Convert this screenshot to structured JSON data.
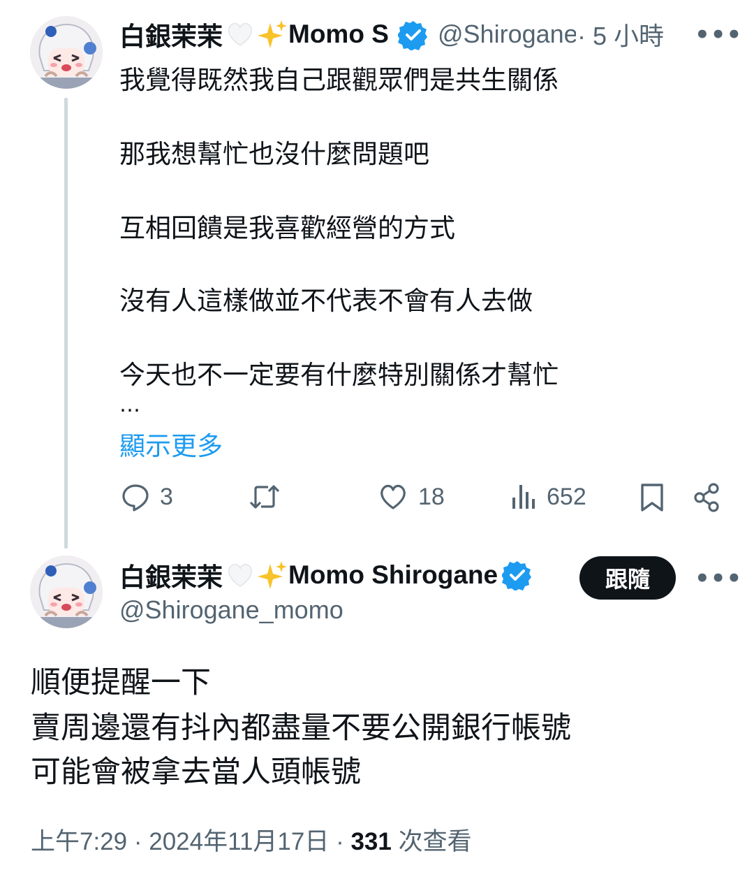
{
  "reply_tweet": {
    "display_name_prefix": "白銀茉茉",
    "display_name_suffix": "Momo S",
    "handle": "@Shirogane",
    "time": "· 5 小時",
    "lines": [
      "我覺得既然我自己跟觀眾們是共生關係",
      "那我想幫忙也沒什麼問題吧",
      "互相回饋是我喜歡經營的方式",
      "沒有人這樣做並不代表不會有人去做",
      "今天也不一定要有什麼特別關係才幫忙",
      "…"
    ],
    "show_more": "顯示更多",
    "actions": {
      "reply_count": "3",
      "retweet_count": "",
      "like_count": "18",
      "view_count": "652"
    }
  },
  "main_tweet": {
    "display_name_prefix": "白銀茉茉",
    "display_name_suffix": "Momo Shirogane",
    "handle": "@Shirogane_momo",
    "follow_label": "跟隨",
    "lines": [
      "順便提醒一下",
      "賣周邊還有抖內都盡量不要公開銀行帳號",
      "可能會被拿去當人頭帳號"
    ],
    "timestamp": "上午7:29 · 2024年11月17日 ·",
    "views_count": "331",
    "views_label": "次查看"
  },
  "icons": {
    "verified": "verified-badge-icon",
    "heart_white": "white-heart-icon",
    "sparkles": "sparkles-icon",
    "more": "more-icon",
    "reply": "reply-icon",
    "retweet": "retweet-icon",
    "like": "heart-icon",
    "views": "views-icon",
    "bookmark": "bookmark-icon",
    "share": "share-icon"
  },
  "colors": {
    "link": "#1d9bf0",
    "verified": "#1d9bf0",
    "text": "#0f1419",
    "muted": "#536471"
  }
}
